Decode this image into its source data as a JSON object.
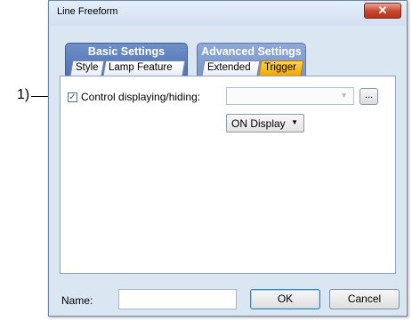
{
  "annotation": {
    "callout": "1)"
  },
  "window": {
    "title": "Line Freeform",
    "close_glyph": "✕"
  },
  "tabs": {
    "basic": {
      "label": "Basic Settings",
      "subtabs": [
        "Style",
        "Lamp Feature"
      ]
    },
    "advanced": {
      "label": "Advanced Settings",
      "subtabs": [
        "Extended",
        "Trigger"
      ],
      "active": "Trigger"
    }
  },
  "trigger": {
    "checkbox_label": "Control displaying/hiding:",
    "checked": true,
    "device_value": "",
    "browse_label": "...",
    "mode_value": "ON Display"
  },
  "footer": {
    "name_label": "Name:",
    "name_value": "",
    "ok_label": "OK",
    "cancel_label": "Cancel"
  },
  "colors": {
    "dialog_bg": "#dbe6f3",
    "tab_group": "#5577b8",
    "active_tab": "#f5b400",
    "close_button": "#c7442c"
  }
}
